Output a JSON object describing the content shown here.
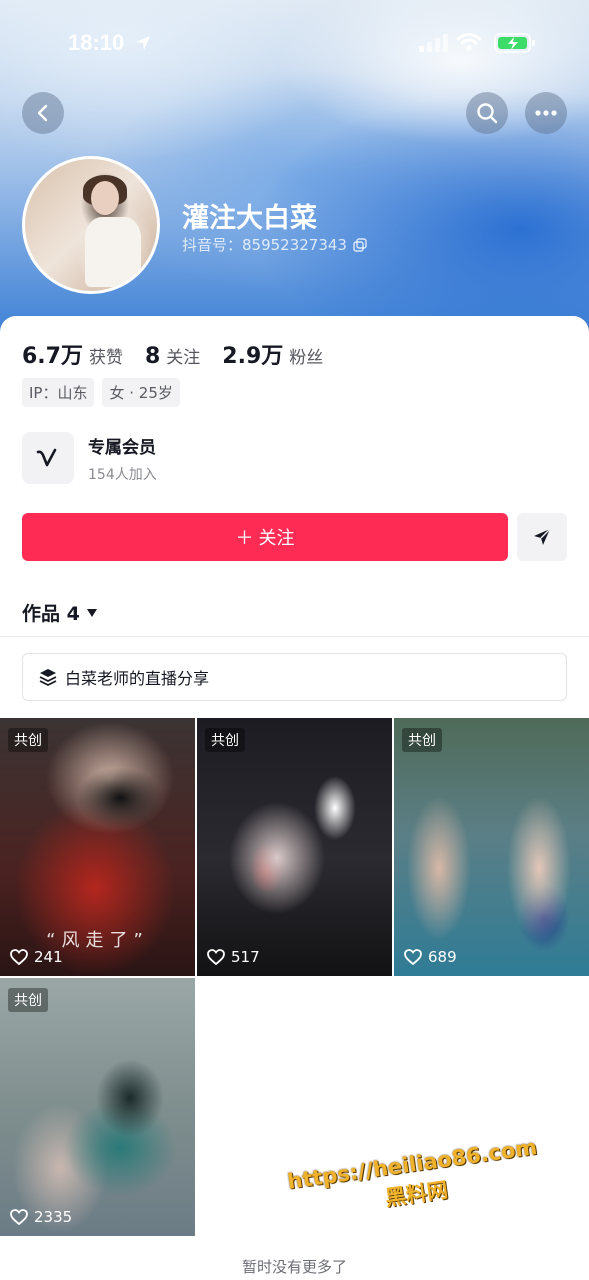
{
  "status_bar": {
    "time": "18:10"
  },
  "profile": {
    "username": "灌注大白菜",
    "douyin_id": "抖音号：85952327343"
  },
  "stats": [
    {
      "value": "6.7万",
      "label": "获赞"
    },
    {
      "value": "8",
      "label": "关注"
    },
    {
      "value": "2.9万",
      "label": "粉丝"
    }
  ],
  "tags": [
    "IP：山东",
    "女 · 25岁"
  ],
  "member": {
    "title": "专属会员",
    "subtitle": "154人加入"
  },
  "actions": {
    "follow_label": "＋ 关注"
  },
  "works": {
    "tab_label": "作品 4"
  },
  "collection": {
    "label": "白菜老师的直播分享"
  },
  "videos": [
    {
      "badge": "共创",
      "likes": "241",
      "caption": "“风走了”"
    },
    {
      "badge": "共创",
      "likes": "517"
    },
    {
      "badge": "共创",
      "likes": "689"
    },
    {
      "badge": "共创",
      "likes": "2335"
    }
  ],
  "footer": {
    "no_more": "暂时没有更多了"
  },
  "watermark": {
    "url": "https://heiliao86.com",
    "name": "黑料网"
  },
  "colors": {
    "accent": "#fe2c55"
  }
}
